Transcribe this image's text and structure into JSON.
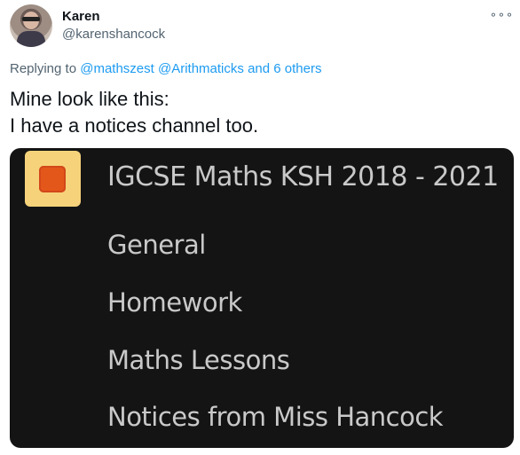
{
  "tweet": {
    "author_name": "Karen",
    "author_handle": "@karenshancock",
    "replying_to_prefix": "Replying to",
    "replying_to_users": "@mathszest @Arithmaticks",
    "replying_to_suffix": "and 6 others",
    "text_line1": "Mine look like this:",
    "text_line2": "I have a notices channel too."
  },
  "media": {
    "team_name": "IGCSE Maths KSH 2018 - 2021",
    "channels": [
      {
        "label": "General"
      },
      {
        "label": "Homework"
      },
      {
        "label": "Maths Lessons"
      },
      {
        "label": "Notices from Miss Hancock"
      }
    ],
    "team_icon_color": "#e4571a",
    "team_icon_bg": "#f6d37b"
  },
  "icons": {
    "more": "more-horizontal-icon"
  }
}
